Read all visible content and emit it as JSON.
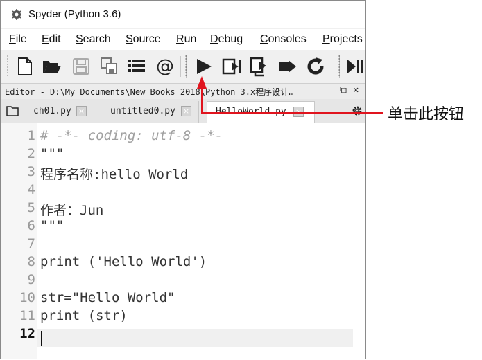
{
  "window": {
    "title": "Spyder (Python 3.6)"
  },
  "menu": [
    "File",
    "Edit",
    "Search",
    "Source",
    "Run",
    "Debug",
    "Consoles",
    "Projects"
  ],
  "toolbar": {
    "icons": [
      "new-file-icon",
      "open-folder-icon",
      "save-icon",
      "save-all-icon",
      "list-icon",
      "at-icon",
      "run-icon",
      "run-cell-icon",
      "run-cell-advance-icon",
      "run-selection-icon",
      "rerun-icon",
      "debug-icon"
    ],
    "at_glyph": "@"
  },
  "editor": {
    "header_path": "Editor - D:\\My Documents\\New Books 2018\\Python 3.x程序设计…",
    "tabs": [
      {
        "label": "ch01.py",
        "active": false
      },
      {
        "label": "untitled0.py",
        "active": false
      },
      {
        "label": "HelloWorld.py",
        "active": true
      }
    ],
    "close_glyph": "×",
    "lines": [
      {
        "n": "1",
        "text": "# -*- coding: utf-8 -*-",
        "comment": true
      },
      {
        "n": "2",
        "text": "\"\"\""
      },
      {
        "n": "3",
        "text": "程序名称:hello World"
      },
      {
        "n": "4",
        "text": ""
      },
      {
        "n": "5",
        "text": "作者：Jun"
      },
      {
        "n": "6",
        "text": "\"\"\""
      },
      {
        "n": "7",
        "text": ""
      },
      {
        "n": "8",
        "text": "print ('Hello World')"
      },
      {
        "n": "9",
        "text": ""
      },
      {
        "n": "10",
        "text": "str=\"Hello World\""
      },
      {
        "n": "11",
        "text": "print (str)"
      },
      {
        "n": "12",
        "text": "",
        "current": true
      }
    ]
  },
  "annotation": {
    "text": "单击此按钮",
    "color": "#e0141e"
  }
}
